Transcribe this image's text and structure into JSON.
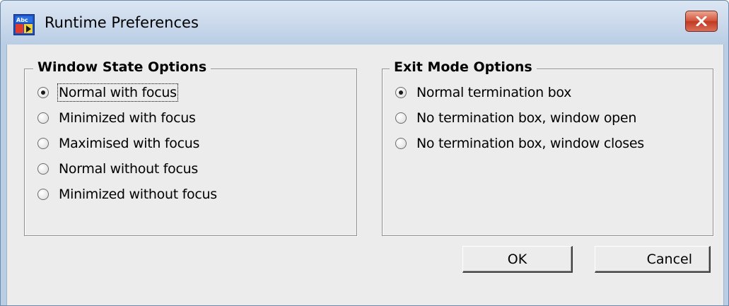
{
  "window": {
    "title": "Runtime Preferences",
    "app_icon": "program-icon",
    "close_icon": "close-icon"
  },
  "window_state": {
    "legend": "Window State Options",
    "selected_index": 0,
    "options": [
      {
        "label": "Normal with focus",
        "checked": true
      },
      {
        "label": "Minimized with focus",
        "checked": false
      },
      {
        "label": "Maximised with focus",
        "checked": false
      },
      {
        "label": "Normal without focus",
        "checked": false
      },
      {
        "label": "Minimized without focus",
        "checked": false
      }
    ]
  },
  "exit_mode": {
    "legend": "Exit Mode Options",
    "selected_index": 0,
    "options": [
      {
        "label": "Normal termination box",
        "checked": true
      },
      {
        "label": "No termination box, window open",
        "checked": false
      },
      {
        "label": "No termination box, window closes",
        "checked": false
      }
    ]
  },
  "buttons": {
    "ok_label": "OK",
    "cancel_label": "Cancel"
  },
  "colors": {
    "titlebar": "#c6d6ea",
    "client": "#ececec",
    "close_button": "#c8462e"
  }
}
